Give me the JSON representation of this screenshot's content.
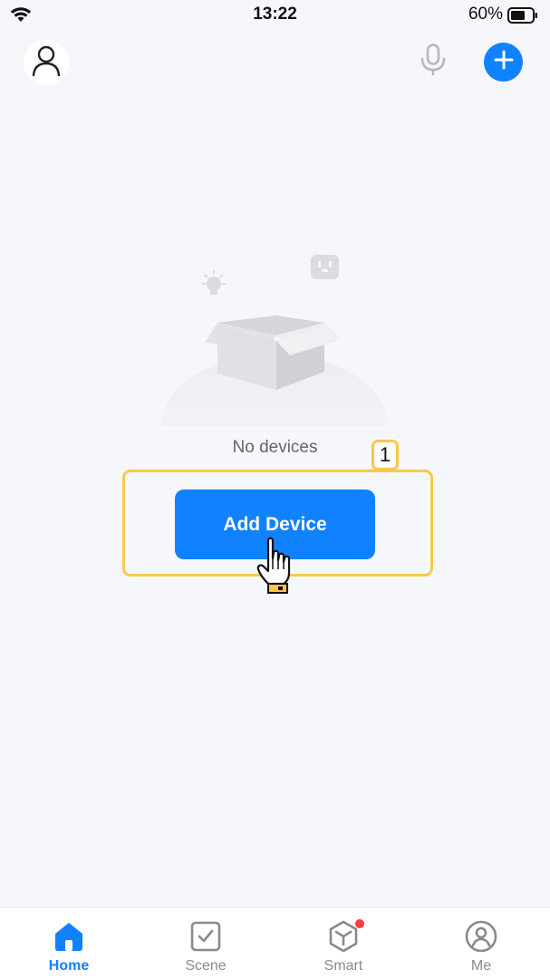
{
  "status_bar": {
    "time": "13:22",
    "battery_percent": "60%",
    "icons": [
      "wifi-icon",
      "battery-icon"
    ]
  },
  "header": {
    "profile_icon": "person-icon",
    "voice_icon": "microphone-icon",
    "add_icon": "plus-icon"
  },
  "empty_state": {
    "message": "No devices",
    "illustration": "empty-box-with-bulb-and-socket"
  },
  "annotation": {
    "step_number": "1"
  },
  "primary_action": {
    "label": "Add Device"
  },
  "tab_bar": {
    "active": "Home",
    "tabs": [
      {
        "label": "Home",
        "icon": "home-icon"
      },
      {
        "label": "Scene",
        "icon": "checkbox-icon"
      },
      {
        "label": "Smart",
        "icon": "cube-icon",
        "badge": true
      },
      {
        "label": "Me",
        "icon": "profile-circle-icon"
      }
    ]
  },
  "colors": {
    "accent": "#1082ff",
    "background": "#f6f7fa",
    "highlight": "#f8c84a",
    "badge_dot": "#ff3b3b"
  }
}
